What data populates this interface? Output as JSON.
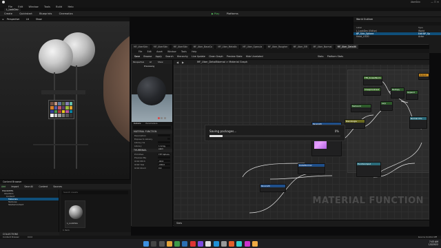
{
  "window": {
    "project_label": "UberSkin",
    "map_tab": "L_LookDev"
  },
  "main_menu": [
    "File",
    "Edit",
    "Window",
    "Tools",
    "Build",
    "Help"
  ],
  "main_toolbar": {
    "buttons": [
      "Create",
      "Quickstart",
      "Blueprints",
      "Cinematics"
    ],
    "play": "Play",
    "platforms": "Platforms"
  },
  "viewport": {
    "buttons": [
      "Perspective",
      "Lit",
      "Show"
    ]
  },
  "outliner": {
    "title": "World Outliner",
    "header_label": "Label",
    "header_type": "Type",
    "rows": [
      {
        "label": "L_LookDev (Editor)",
        "type": "World",
        "selected": false
      },
      {
        "label": "BP_Skin_Sphere",
        "type": "Edit BP_Sp",
        "selected": true
      },
      {
        "label": "Head_LOD0",
        "type": "Actor",
        "selected": false
      }
    ]
  },
  "material_editor": {
    "tabs": [
      "MF_UberSkin",
      "MF_UberSkin",
      "MF_UberSkin",
      "MF_Uber_BaseCo",
      "MF_Uber_Metallic",
      "MF_Uber_Specula",
      "MF_Uber_Rougher",
      "MF_Uber_EIR",
      "MF_Uber_Normal",
      "MF_Uber_DetailN"
    ],
    "menu": [
      "File",
      "Edit",
      "Asset",
      "Window",
      "Tools",
      "Help"
    ],
    "toolbar": [
      "Save",
      "Browse",
      "Apply",
      "Search",
      "Hierarchy",
      "Live Update",
      "Clean Graph",
      "Preview State",
      "Hide Unrelated"
    ],
    "toolbar_right": [
      "Stats",
      "Platform Stats"
    ],
    "breadcrumb": "MF_Uber_DetailNormal > Material Graph",
    "preview_bar": [
      "Perspective",
      "Lit",
      "Show"
    ],
    "preview_label": "Previewing",
    "details_tabs": [
      "Details",
      "Parameters"
    ],
    "details_sections": [
      {
        "title": "MATERIAL FUNCTION",
        "rows": [
          {
            "label": "Description",
            "value": ""
          },
          {
            "label": "Expose to Library",
            "value": ""
          },
          {
            "label": "Library Ca",
            "value": ""
          },
          {
            "label": "Library",
            "value": "1 Array elem"
          }
        ]
      },
      {
        "title": "THUMBNAIL",
        "rows": [
          {
            "label": "Primitive",
            "value": "TPT Sphere"
          },
          {
            "label": "Preview Ma",
            "value": ""
          },
          {
            "label": "Orbit Pitch",
            "value": "-90.0"
          },
          {
            "label": "Orbit Yaw",
            "value": "-180.0"
          },
          {
            "label": "Orbit Zoom",
            "value": "0.0"
          }
        ]
      }
    ],
    "saving": {
      "text": "Saving packages...",
      "percent": "0%",
      "progress": 0.1
    },
    "watermark": "MATERIAL FUNCTION",
    "stats_tab": "Stats",
    "nodes": [
      {
        "title": "TFR_ScaledNorm",
        "color": "green"
      },
      {
        "title": "CheapContrast",
        "color": "green"
      },
      {
        "title": "TexCoord",
        "color": "olive"
      },
      {
        "title": "Multiply",
        "color": "dgreen"
      },
      {
        "title": "Append",
        "color": "dgreen"
      },
      {
        "title": "Lerp",
        "color": "dgreen"
      },
      {
        "title": "Param2D",
        "color": "blue"
      },
      {
        "title": "DetailNormal",
        "color": "blue"
      },
      {
        "title": "Output",
        "color": "orange"
      },
      {
        "title": "BlendAngle",
        "color": "teal"
      },
      {
        "title": "Normal UVs",
        "color": "teal"
      },
      {
        "title": "FunctionInput",
        "color": "teal"
      }
    ]
  },
  "content_browser": {
    "tab": "Content Browser",
    "toolbar": [
      "Add",
      "Import",
      "Save All",
      "Content",
      "Sources"
    ],
    "tree_header": "FAVORITES",
    "tree": [
      {
        "label": "UberSkin",
        "selected": false
      },
      {
        "label": "Content",
        "selected": false
      },
      {
        "label": "Materials",
        "selected": true
      },
      {
        "label": "Textures",
        "selected": false
      },
      {
        "label": "StarterContent",
        "selected": false
      }
    ],
    "asset_name": "L_LookDev",
    "asset_count": "1 item",
    "collections": "COLLECTIONS",
    "filter_placeholder": "Search Assets"
  },
  "status_bar": {
    "left": [
      "Content Drawer",
      "Cmd"
    ],
    "right": "Source Control Off"
  },
  "taskbar": {
    "time": "7:03 AM",
    "date": "1/5/2022"
  }
}
